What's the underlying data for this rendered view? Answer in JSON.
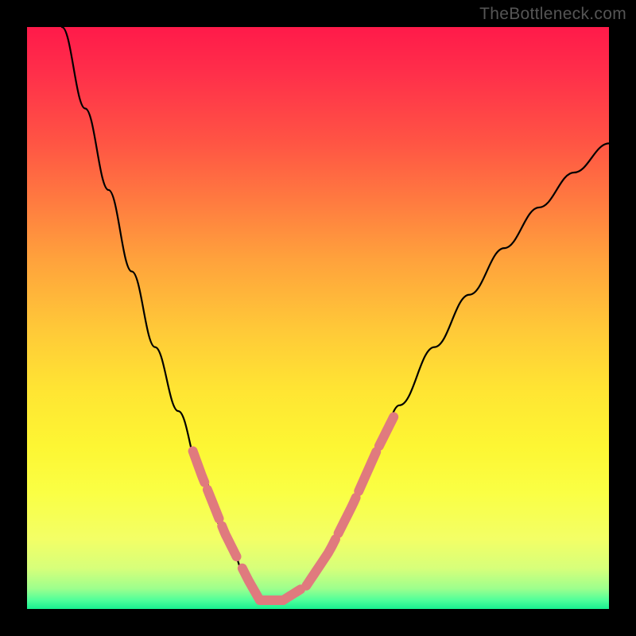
{
  "watermark": "TheBottleneck.com",
  "chart_data": {
    "type": "line",
    "title": "",
    "xlabel": "",
    "ylabel": "",
    "series": [
      {
        "name": "curve",
        "x": [
          0.06,
          0.1,
          0.14,
          0.18,
          0.22,
          0.26,
          0.3,
          0.34,
          0.38,
          0.4,
          0.44,
          0.48,
          0.52,
          0.56,
          0.6,
          0.64,
          0.7,
          0.76,
          0.82,
          0.88,
          0.94,
          1.0
        ],
        "y": [
          1.0,
          0.86,
          0.72,
          0.58,
          0.45,
          0.34,
          0.23,
          0.13,
          0.05,
          0.015,
          0.015,
          0.04,
          0.1,
          0.18,
          0.27,
          0.35,
          0.45,
          0.54,
          0.62,
          0.69,
          0.75,
          0.8
        ]
      }
    ],
    "marker_segments_x": [
      [
        0.285,
        0.305
      ],
      [
        0.31,
        0.33
      ],
      [
        0.335,
        0.36
      ],
      [
        0.37,
        0.4
      ],
      [
        0.4,
        0.44
      ],
      [
        0.44,
        0.47
      ],
      [
        0.48,
        0.53
      ],
      [
        0.535,
        0.565
      ],
      [
        0.57,
        0.6
      ],
      [
        0.605,
        0.63
      ]
    ],
    "xlim": [
      0,
      1
    ],
    "ylim": [
      0,
      1
    ]
  },
  "colors": {
    "curve": "#000000",
    "marker": "#e07a7e",
    "frame": "#000000"
  }
}
